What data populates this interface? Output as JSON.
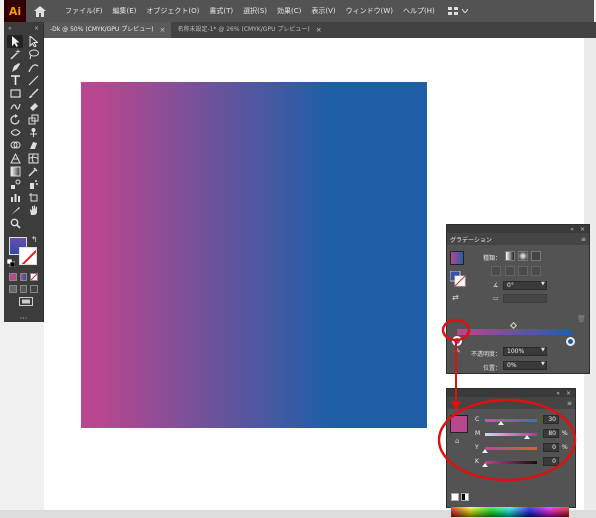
{
  "app": {
    "logo": "Ai"
  },
  "menu": [
    "ファイル(F)",
    "編集(E)",
    "オブジェクト(O)",
    "書式(T)",
    "選択(S)",
    "効果(C)",
    "表示(V)",
    "ウィンドウ(W)",
    "ヘルプ(H)"
  ],
  "tabs": [
    {
      "label": "-Dk @ 50% (CMYK/GPU プレビュー)",
      "close": "×",
      "active": true
    },
    {
      "label": "名称未設定-1* @ 26% (CMYK/GPU プレビュー)",
      "close": "×",
      "active": false
    }
  ],
  "toolbar": {
    "more": "···"
  },
  "artwork": {
    "gradient_start": "#b9468f",
    "gradient_end": "#1e5fa8"
  },
  "gradient_panel": {
    "title": "グラデーション",
    "type_label": "種類：",
    "angle": "0°",
    "opacity_label": "不透明度：",
    "opacity": "100%",
    "position_label": "位置：",
    "position": "0%"
  },
  "color_panel": {
    "swatch_color": "#b9468f",
    "channels": [
      {
        "letter": "C",
        "value": "30",
        "unit": "",
        "level": 0.3,
        "color_start": "#e04aa0",
        "color_end": "#3a70c0"
      },
      {
        "letter": "M",
        "value": "80",
        "unit": "%",
        "level": 0.8,
        "color_start": "#c8d8f0",
        "color_end": "#c0308f"
      },
      {
        "letter": "Y",
        "value": "0",
        "unit": "%",
        "level": 0.0,
        "color_start": "#b9468f",
        "color_end": "#c86a3a"
      },
      {
        "letter": "K",
        "value": "0",
        "unit": "",
        "level": 0.0,
        "color_start": "#b9468f",
        "color_end": "#101010"
      }
    ]
  },
  "colors": {
    "highlight": "#e01010"
  }
}
